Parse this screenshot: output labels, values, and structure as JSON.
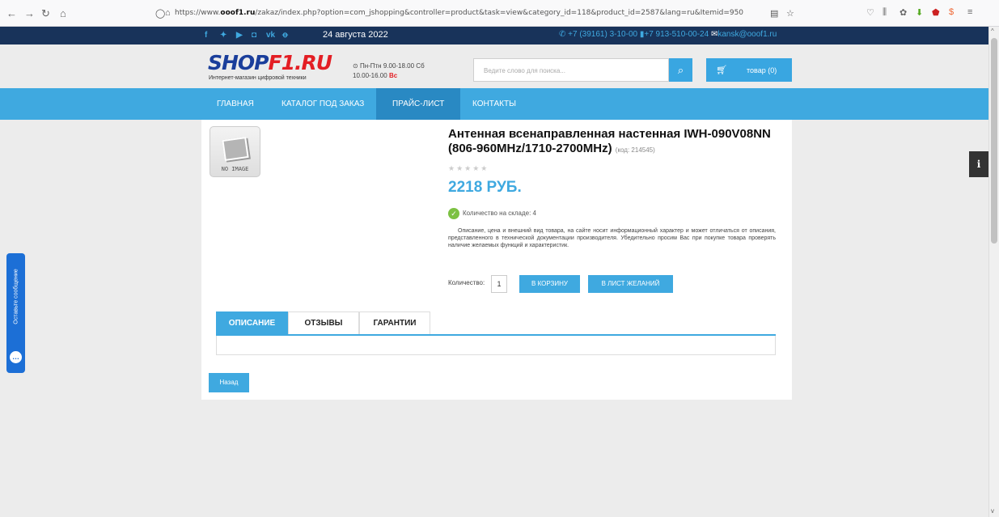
{
  "browser": {
    "url_host": "https://www.ooof1.ru",
    "url_host_bold": "ooof1.ru",
    "url_prefix": "https://www.",
    "url_path": "/zakaz/index.php?option=com_jshopping&controller=product&task=view&category_id=118&product_id=2587&lang=ru&Itemid=950"
  },
  "topbar": {
    "date": "24 августа 2022",
    "phones": "+7 (39161) 3-10-00",
    "mobile": "+7 913-510-00-24",
    "email": "kansk@ooof1.ru"
  },
  "header": {
    "logo_main": "SHOP",
    "logo_accent": "F1.RU",
    "logo_sub": "Интернет-магазин цифровой техники",
    "hours_line1": "Пн-Птн 9.00-18.00   Сб",
    "hours_line2": "10.00-16.00",
    "hours_red": "Вс",
    "search_placeholder": "Ведите слово для поиска...",
    "cart_label": "товар (0)"
  },
  "menu": [
    "ГЛАВНАЯ",
    "КАТАЛОГ ПОД ЗАКАЗ",
    "ПРАЙС-ЛИСТ",
    "КОНТАКТЫ"
  ],
  "product": {
    "no_image": "NO IMAGE",
    "title": "Антенная всенаправленная настенная IWH-090V08NN (806-960MHz/1710-2700MHz)",
    "code": "(код: 214545)",
    "rating": 0,
    "rating_max": 5,
    "price": "2218 РУБ.",
    "stock": "Количество на складе: 4",
    "description": "Описание, цена и внешний вид товара, на сайте носит информационный характер и может отличаться от описания, представленного в технической документации производителя. Убедительно просим Вас при покупке товара проверять наличие желаемых функций и характеристик.",
    "qty_label": "Количество:",
    "qty_value": "1",
    "to_cart": "В КОРЗИНУ",
    "to_wishlist": "В ЛИСТ ЖЕЛАНИЙ"
  },
  "tabs": [
    "ОПИСАНИЕ",
    "ОТЗЫВЫ",
    "ГАРАНТИИ"
  ],
  "back_label": "Назад",
  "feedback_label": "Оставьте сообщение",
  "colors": {
    "accent": "#3fa9e0",
    "topbar": "#18335a",
    "feedback": "#1c6fd6"
  }
}
